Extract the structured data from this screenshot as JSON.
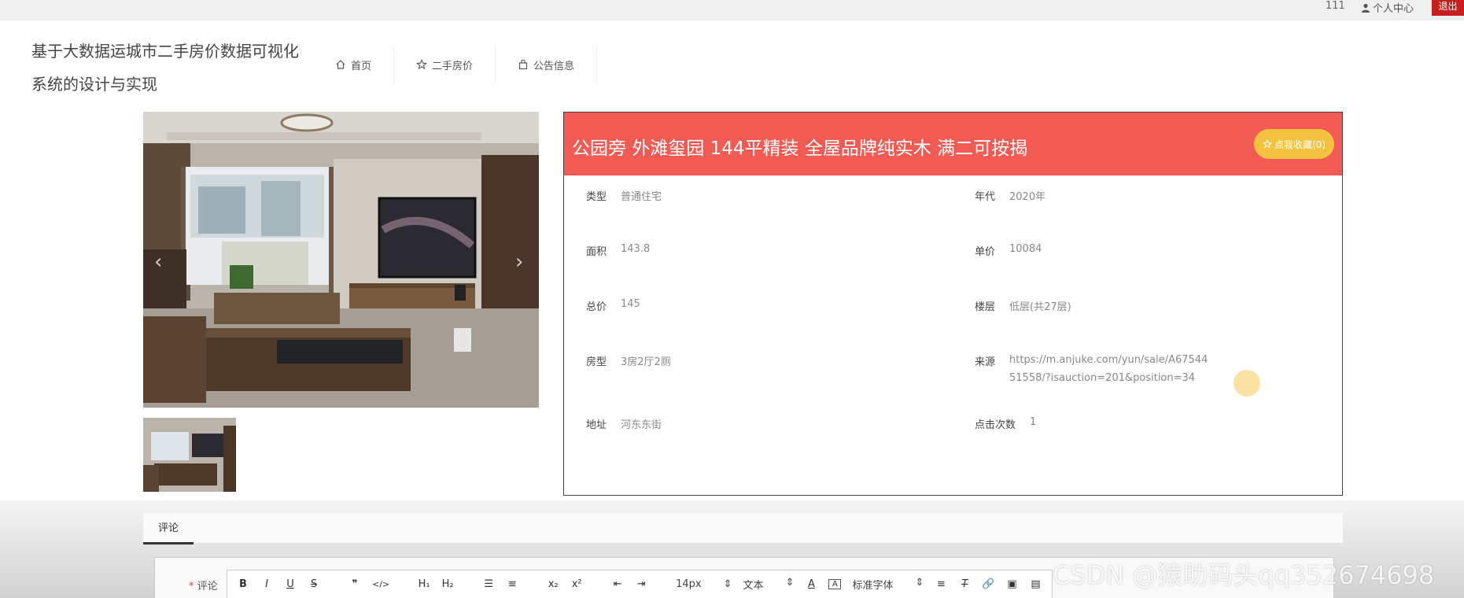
{
  "topbar": {
    "user_id": "111",
    "center_label": "个人中心",
    "logout_label": "退出"
  },
  "brand": {
    "title": "基于大数据运城市二手房价数据可视化系统的设计与实现"
  },
  "nav": {
    "items": [
      {
        "label": "首页",
        "icon": "home-icon"
      },
      {
        "label": "二手房价",
        "icon": "star-icon"
      },
      {
        "label": "公告信息",
        "icon": "bag-icon"
      }
    ]
  },
  "listing": {
    "title": "公园旁 外滩玺园 144平精装 全屋品牌纯实木 满二可按揭",
    "favorite_label": "点我收藏(0)",
    "fields": {
      "type": {
        "label": "类型",
        "value": "普通住宅"
      },
      "year": {
        "label": "年代",
        "value": "2020年"
      },
      "area": {
        "label": "面积",
        "value": "143.8"
      },
      "unit_price": {
        "label": "单价",
        "value": "10084"
      },
      "total_price": {
        "label": "总价",
        "value": "145"
      },
      "floor": {
        "label": "楼层",
        "value": "低层(共27层)"
      },
      "layout": {
        "label": "房型",
        "value": "3房2厅2厕"
      },
      "source": {
        "label": "来源",
        "value": "https://m.anjuke.com/yun/sale/A6754451558/?isauction=201&position=34"
      },
      "address": {
        "label": "地址",
        "value": "河东东街"
      },
      "clicks": {
        "label": "点击次数",
        "value": "1"
      }
    }
  },
  "comments": {
    "tab_label": "评论",
    "field_label": "评论",
    "toolbar": {
      "font_size": "14px",
      "paragraph": "文本",
      "font_family": "标准字体"
    }
  },
  "watermark": "CSDN @猿助码头qq352674698"
}
